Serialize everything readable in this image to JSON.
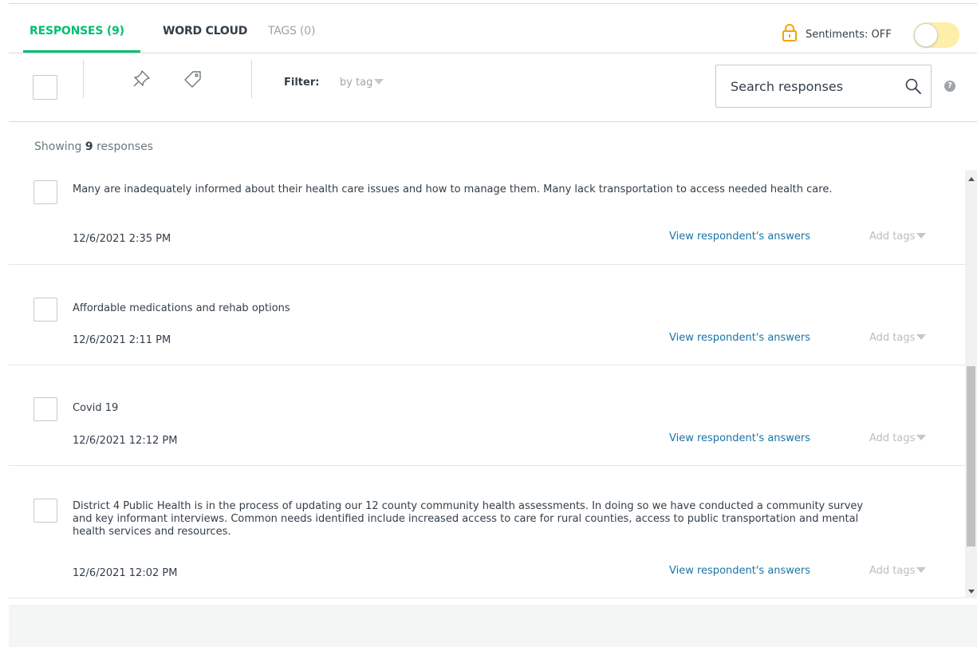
{
  "tabs": [
    {
      "label": "RESPONSES (9)",
      "active": true
    },
    {
      "label": "WORD CLOUD",
      "active": false
    },
    {
      "label": "TAGS (0)",
      "active": false
    }
  ],
  "sentiments": {
    "label": "Sentiments: OFF",
    "on": false,
    "lock_icon": "lock-icon"
  },
  "toolbar": {
    "filter_label": "Filter:",
    "filter_value": "by tag",
    "search_placeholder": "Search responses",
    "icons": [
      "pin-icon",
      "tag-icon",
      "search-icon",
      "help-icon"
    ]
  },
  "showing": {
    "prefix": "Showing",
    "count": "9",
    "suffix": "responses"
  },
  "responses": [
    {
      "text": "Many are inadequately informed about their health care issues and how to manage them. Many lack transportation to access needed health care.",
      "date": "12/6/2021 2:35 PM",
      "view_label": "View respondent's answers",
      "tags_label": "Add tags"
    },
    {
      "text": "Affordable medications and rehab options",
      "date": "12/6/2021 2:11 PM",
      "view_label": "View respondent's answers",
      "tags_label": "Add tags"
    },
    {
      "text": "Covid 19",
      "date": "12/6/2021 12:12 PM",
      "view_label": "View respondent's answers",
      "tags_label": "Add tags"
    },
    {
      "text": "District 4 Public Health is in the process of updating our 12 county community health assessments. In doing so we have conducted a community survey and key informant interviews. Common needs identified include increased access to care for rural counties, access to public transportation and mental health services and resources.",
      "date": "12/6/2021 12:02 PM",
      "view_label": "View respondent's answers",
      "tags_label": "Add tags"
    }
  ],
  "colors": {
    "accent": "#00bf6f",
    "link": "#1a73a8",
    "muted": "#9da4aa",
    "toggle_off": "#fdeea9"
  }
}
